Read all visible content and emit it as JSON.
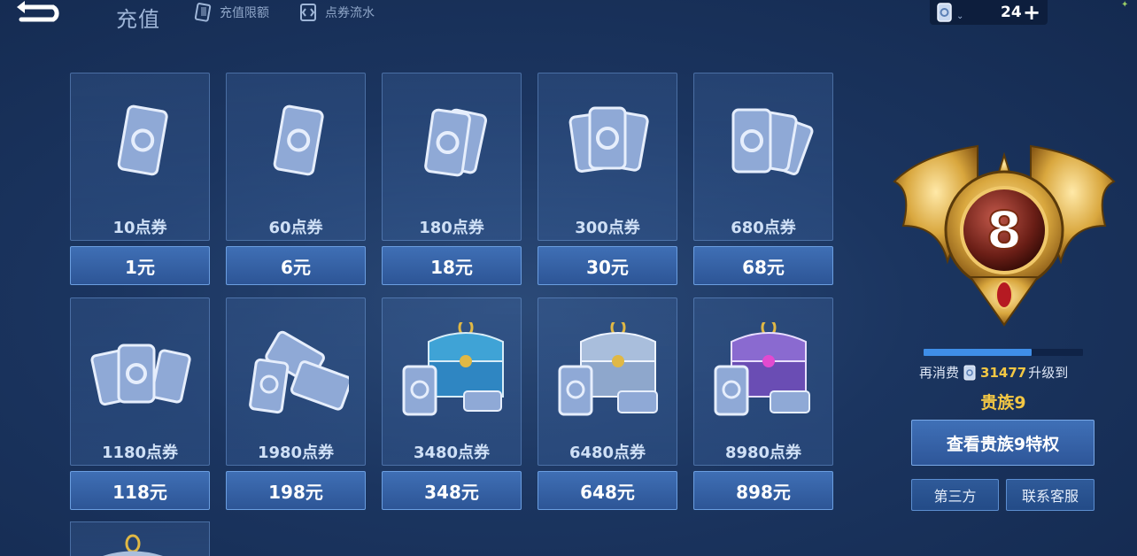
{
  "header": {
    "title": "充值",
    "links": [
      {
        "label": "充值限额",
        "icon": "card-limit-icon"
      },
      {
        "label": "点券流水",
        "icon": "ticket-history-icon"
      }
    ],
    "currency": {
      "amount": "24",
      "add_label": "+",
      "icon": "voucher-coin-icon"
    }
  },
  "products": [
    {
      "points": "10点券",
      "price": "1元",
      "art": "single-card"
    },
    {
      "points": "60点券",
      "price": "6元",
      "art": "single-card"
    },
    {
      "points": "180点券",
      "price": "18元",
      "art": "two-cards"
    },
    {
      "points": "300点券",
      "price": "30元",
      "art": "three-cards"
    },
    {
      "points": "680点券",
      "price": "68元",
      "art": "fan-cards"
    },
    {
      "points": "1180点券",
      "price": "118元",
      "art": "card-pile"
    },
    {
      "points": "1980点券",
      "price": "198元",
      "art": "card-stack"
    },
    {
      "points": "3480点券",
      "price": "348元",
      "art": "blue-chest"
    },
    {
      "points": "6480点券",
      "price": "648元",
      "art": "silver-chest"
    },
    {
      "points": "8980点券",
      "price": "898元",
      "art": "purple-chest"
    }
  ],
  "noble": {
    "current_level": "8",
    "progress_fraction": 0.68,
    "upgrade_prefix": "再消费",
    "upgrade_amount": "31477",
    "upgrade_suffix": "升级到",
    "next_level_label": "贵族9",
    "privilege_button": "查看贵族9特权",
    "third_party_button": "第三方",
    "support_button": "联系客服"
  },
  "colors": {
    "background": "#1b3560",
    "gold": "#f3c744",
    "price_button": "#3f6fb5"
  }
}
